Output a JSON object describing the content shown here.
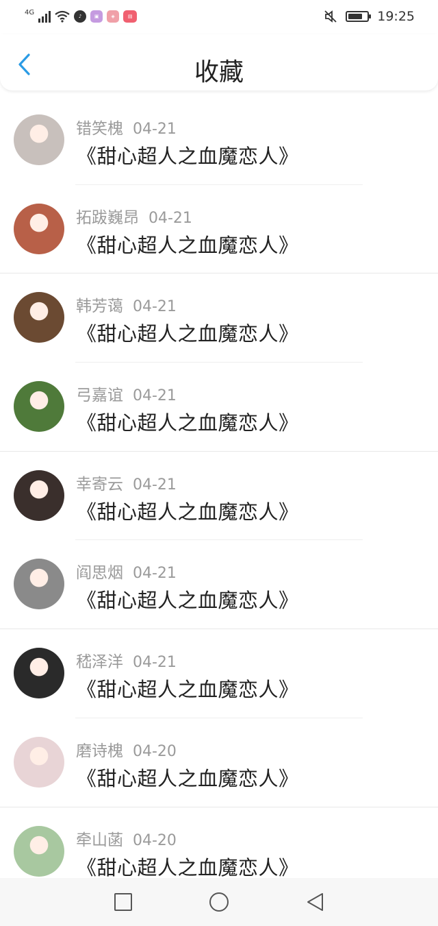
{
  "status": {
    "network": "4G",
    "time": "19:25",
    "battery_level": 0.75,
    "apps": [
      {
        "name": "tiktok-icon",
        "color": "#333333"
      },
      {
        "name": "purple-app-icon",
        "color": "#c59be0"
      },
      {
        "name": "pink-app-icon",
        "color": "#f0a0a8"
      },
      {
        "name": "red-app-icon",
        "color": "#f06070"
      }
    ]
  },
  "header": {
    "title": "收藏",
    "accent": "#2a9be5"
  },
  "items": [
    {
      "name": "错笑槐",
      "date": "04-21",
      "title": "《甜心超人之血魔恋人》",
      "avatar_color": "#c8c0bc"
    },
    {
      "name": "拓跋巍昂",
      "date": "04-21",
      "title": "《甜心超人之血魔恋人》",
      "avatar_color": "#b86048"
    },
    {
      "name": "韩芳蔼",
      "date": "04-21",
      "title": "《甜心超人之血魔恋人》",
      "avatar_color": "#6b4a32"
    },
    {
      "name": "弓嘉谊",
      "date": "04-21",
      "title": "《甜心超人之血魔恋人》",
      "avatar_color": "#4f7a3a"
    },
    {
      "name": "幸寄云",
      "date": "04-21",
      "title": "《甜心超人之血魔恋人》",
      "avatar_color": "#3a2f2c"
    },
    {
      "name": "阎思烟",
      "date": "04-21",
      "title": "《甜心超人之血魔恋人》",
      "avatar_color": "#8a8a8a"
    },
    {
      "name": "嵇泽洋",
      "date": "04-21",
      "title": "《甜心超人之血魔恋人》",
      "avatar_color": "#2a2a2a"
    },
    {
      "name": "磨诗槐",
      "date": "04-20",
      "title": "《甜心超人之血魔恋人》",
      "avatar_color": "#e8d4d6"
    },
    {
      "name": "牵山菡",
      "date": "04-20",
      "title": "《甜心超人之血魔恋人》",
      "avatar_color": "#a8c8a0"
    }
  ]
}
